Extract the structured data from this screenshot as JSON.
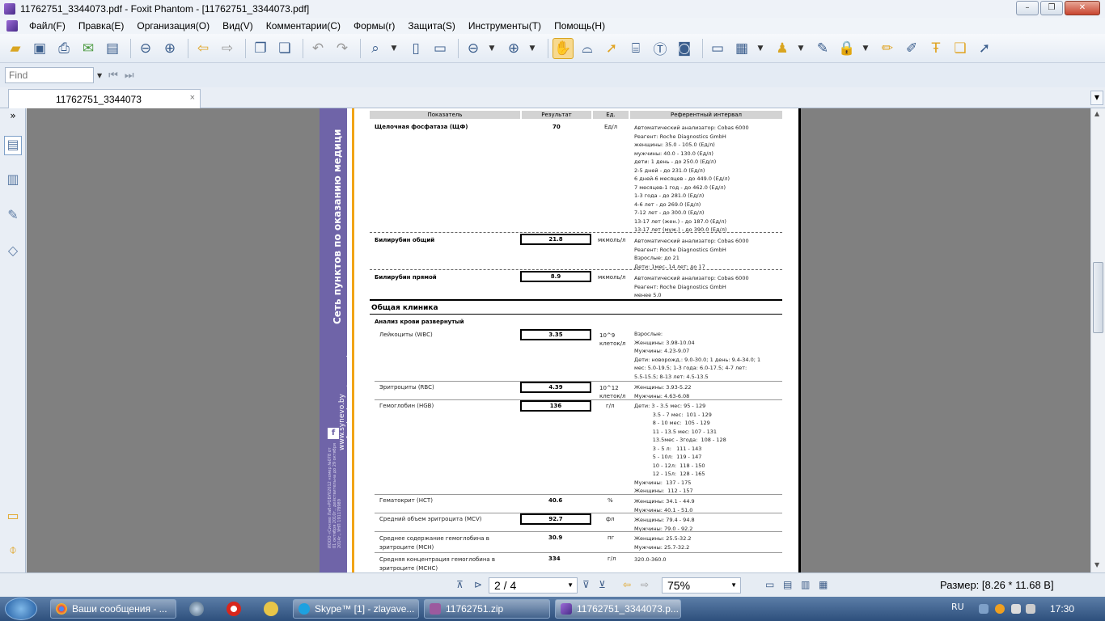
{
  "window": {
    "title": "11762751_3344073.pdf - Foxit Phantom - [11762751_3344073.pdf]",
    "controls": [
      "–",
      "❐",
      "✕"
    ]
  },
  "menu": [
    "Файл(F)",
    "Правка(E)",
    "Организация(O)",
    "Вид(V)",
    "Комментарии(C)",
    "Формы(r)",
    "Защита(S)",
    "Инструменты(T)",
    "Помощь(H)"
  ],
  "find": {
    "placeholder": "Find"
  },
  "tab": {
    "label": "11762751_3344073",
    "close": "×"
  },
  "document": {
    "sidebar_text": {
      "network": "Сеть пунктов по оказанию медици",
      "site1": "www.synevo.by",
      "site2": "www.facebook.com/synevo.by",
      "fb": "f",
      "licence": "ИООО «Синэво Лаб»РОБУ02012 номер №078 от 01 октября 2010г., действительна до 29 октября 2014г., УНП 191178989"
    },
    "headers": [
      "Показатель",
      "Результат",
      "Ед.",
      "Референтный интервал"
    ],
    "section_title": "Общая клиника",
    "subsection_title": "Анализ крови развернутый",
    "rows": [
      {
        "name": "Щелочная фосфатаза (ЩФ)",
        "result": "70",
        "unit": "Ед/л",
        "ref": "Автоматический анализатор: Cobas 6000\nРеагент: Roche Diagnostics GmbH\nженщины: 35.0 - 105.0 (Ед/л)\nмужчины: 40.0 - 130.0 (Ед/л)\nдети: 1 день - до 250.0 (Ед/л)\n2-5 дней - до 231.0 (Ед/л)\n6 дней-6 месяцев - до 449.0 (Ед/л)\n7 месяцев-1 год - до 462.0 (Ед/л)\n1-3 года - до 281.0 (Ед/л)\n4-6 лет - до 269.0 (Ед/л)\n7-12 лет - до 300.0 (Ед/л)\n13-17 лет (жен.) - до 187.0 (Ед/л)\n13-17 лет (муж.) - до 390.0 (Ед/л)"
      },
      {
        "name": "Билирубин общий",
        "result": "21.8",
        "unit": "мкмоль/л",
        "ref": "Автоматический анализатор: Cobas 6000\nРеагент: Roche Diagnostics GmbH\nВзрослые: до 21\nДети: 1мес- 14 лет: до 17"
      },
      {
        "name": "Билирубин прямой",
        "result": "8.9",
        "unit": "мкмоль/л",
        "ref": "Автоматический анализатор: Cobas 6000\nРеагент: Roche Diagnostics GmbH\nменее 5.0"
      },
      {
        "name": "Лейкоциты (WBC)",
        "result": "3.35",
        "unit": "10^9\nклеток/л",
        "ref": "Взрослые:\nЖенщины: 3.98-10.04\nМужчины: 4.23-9.07\nДети: новорожд.: 9.0-30.0; 1 день: 9.4-34.0; 1\nмес: 5.0-19.5; 1-3 года: 6.0-17.5; 4-7 лет:\n5.5-15.5; 8-13 лет: 4.5-13.5"
      },
      {
        "name": "Эритроциты (RBC)",
        "result": "4.39",
        "unit": "10^12\nклеток/л",
        "ref": "Женщины: 3.93-5.22\nМужчины: 4.63-6.08"
      },
      {
        "name": "Гемоглобин (HGB)",
        "result": "136",
        "unit": "г/л",
        "ref": "Дети: 3 - 3.5 мес: 95 - 129\n           3.5 - 7 мес:  101 - 129\n           8 - 10 мес:  105 - 129\n           11 - 13.5 мес: 107 - 131\n           13.5мес - 3года:  108 - 128\n           3 - 5 л:   111 - 143\n           5 - 10л:  119 - 147\n           10 - 12л:  118 - 150\n           12 - 15л:  128 - 165\nМужчины:  137 - 175\nЖенщины:  112 - 157"
      },
      {
        "name": "Гематокрит (HCT)",
        "result": "40.6",
        "unit": "%",
        "ref": "Женщины: 34.1 - 44.9\nМужчины: 40.1 - 51.0"
      },
      {
        "name": "Средний объем эритроцита (MCV)",
        "result": "92.7",
        "unit": "фл",
        "ref": "Женщины: 79.4 - 94.8\nМужчины: 79.0 - 92.2"
      },
      {
        "name": "Среднее содержание гемоглобина в\nэритроците (MCH)",
        "result": "30.9",
        "unit": "пг",
        "ref": "Женщины: 25.5-32.2\nМужчины: 25.7-32.2"
      },
      {
        "name": "Средняя концентрация гемоглобина в\nэритроците (MCHC)",
        "result": "334",
        "unit": "г/л",
        "ref": "320.0-360.0"
      }
    ]
  },
  "statusbar": {
    "page": "2 / 4",
    "zoom": "75%",
    "size": "Размер: [8.26 * 11.68 В]"
  },
  "taskbar": {
    "tasks": [
      "Ваши сообщения - ...",
      "Skype™ [1] - zlayave...",
      "11762751.zip",
      "11762751_3344073.p..."
    ],
    "lang": "RU",
    "clock": "17:30"
  },
  "colors": {
    "sidebar_purple": "#6f64a8",
    "accent_orange": "#f1a417"
  }
}
